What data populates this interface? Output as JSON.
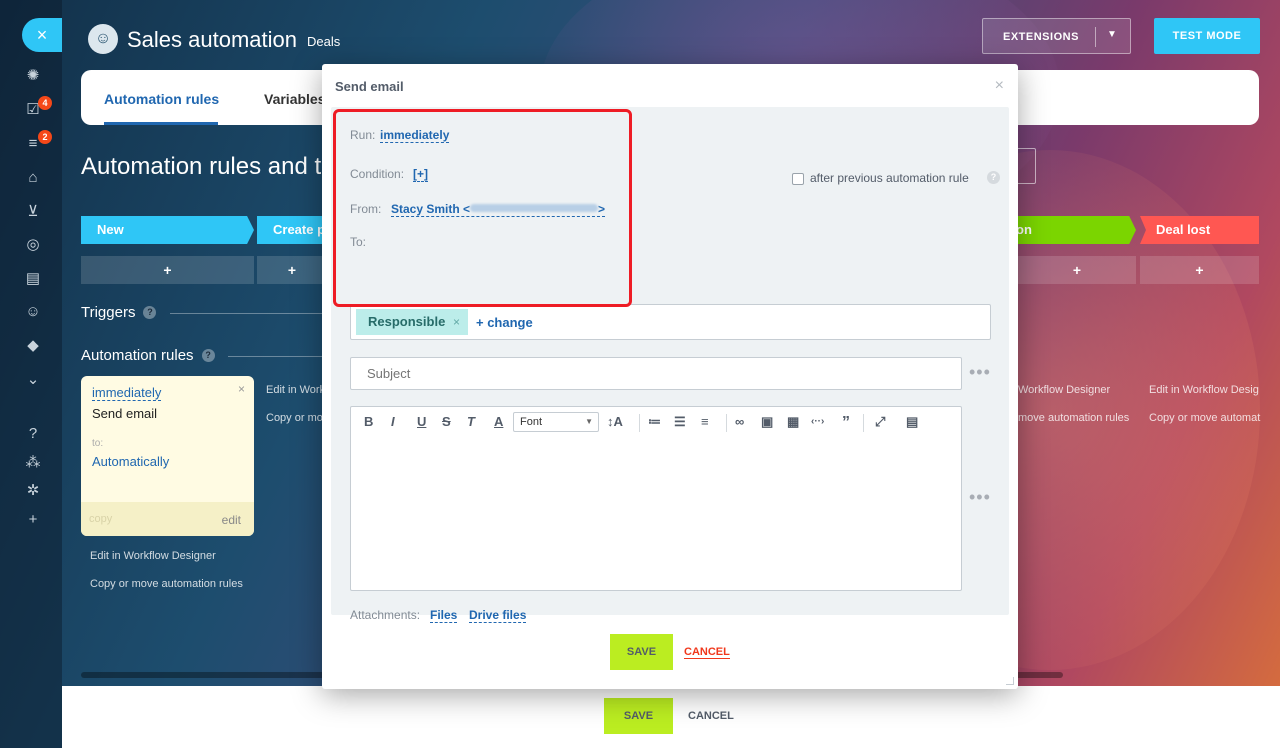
{
  "header": {
    "title": "Sales automation",
    "subtitle": "Deals",
    "extensions_label": "EXTENSIONS",
    "test_mode_label": "TEST MODE"
  },
  "sidebar": {
    "close_icon": "×",
    "badges": [
      "4",
      "2"
    ],
    "icons": [
      "activity-icon",
      "tasks-icon",
      "crm-icon",
      "bank-icon",
      "cart-icon",
      "target-icon",
      "contact-card-icon",
      "robot-icon",
      "box-icon",
      "more-icon",
      "help-icon",
      "sitemap-icon",
      "settings-icon",
      "add-icon"
    ]
  },
  "tabs": [
    {
      "label": "Automation rules",
      "active": true
    },
    {
      "label": "Variables",
      "active": false
    }
  ],
  "page_heading": "Automation rules and triggers",
  "stages": [
    {
      "label": "New",
      "color": "#2fc6f6"
    },
    {
      "label": "Create p",
      "color": "#2fc6f6"
    },
    {
      "label": "on",
      "color": "#7bd500"
    },
    {
      "label": "Deal lost",
      "color": "#ff5752"
    }
  ],
  "plus_label": "+",
  "triggers_label": "Triggers",
  "automation_rules_label": "Automation rules",
  "help_glyph": "?",
  "rule_card": {
    "when": "immediately",
    "action": "Send email",
    "to_label": "to:",
    "to_value": "Automatically",
    "copy": "copy",
    "edit": "edit",
    "close": "×"
  },
  "links": {
    "edit_designer": "Edit in Workflow Designer",
    "copy_move": "Copy or move automation rules",
    "edit_designer_short": "Edit in Workflo",
    "copy_move_short": "Copy or move",
    "edit_designer_right": "Workflow Designer",
    "copy_move_right": "move automation rules",
    "edit_designer_far": "Edit in Workflow Desig",
    "copy_move_far": "Copy or move automat"
  },
  "bottom": {
    "save": "SAVE",
    "cancel": "CANCEL"
  },
  "modal": {
    "title": "Send email",
    "close": "×",
    "run_label": "Run:",
    "run_value": "immediately",
    "after_previous_label": "after previous automation rule",
    "after_previous_checked": false,
    "condition_label": "Condition:",
    "condition_value": "[+]",
    "from_label": "From:",
    "from_value": "Stacy Smith <",
    "from_close": ">",
    "to_label": "To:",
    "to_tag": "Responsible",
    "to_tag_remove": "×",
    "to_change": "+ change",
    "subject_placeholder": "Subject",
    "font_select": "Font",
    "attachments_label": "Attachments:",
    "attach_files": "Files",
    "attach_drive": "Drive files",
    "save": "SAVE",
    "cancel": "CANCEL",
    "dots": "•••"
  },
  "toolbar_glyphs": {
    "bold": "B",
    "italic": "I",
    "underline": "U",
    "strike": "S",
    "clear": "T",
    "color": "A",
    "size": "↕A",
    "ol": "≔",
    "ul": "☰",
    "align": "≡",
    "link": "∞",
    "image": "▣",
    "table": "▦",
    "code": "‹··›",
    "quote": "”",
    "fullscreen": "⤢",
    "media": "▤"
  },
  "highlight_color": "#ee1c25"
}
